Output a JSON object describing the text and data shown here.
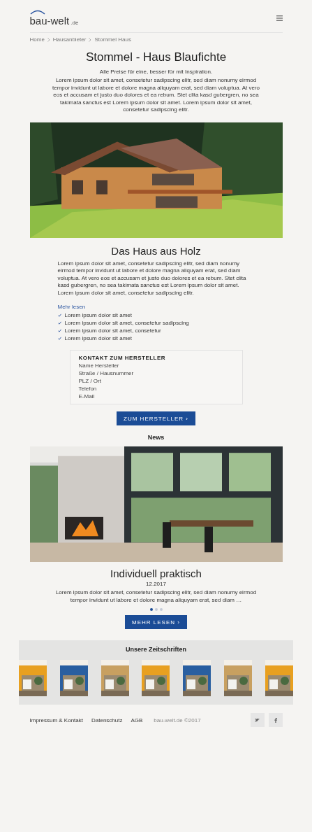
{
  "header": {
    "logo": "bau-welt",
    "logo_suffix": ".de"
  },
  "breadcrumb": [
    "Home",
    "Hausanbieter",
    "Stommel Haus"
  ],
  "title": "Stommel - Haus Blaufichte",
  "intro": "Alle Preise für eine, besser für mit Inspiration.",
  "description": "Lorem ipsum dolor sit amet, consetetur sadipscing elitr, sed diam nonumy eirmod tempor invidunt ut labore et dolore magna aliquyam erat, sed diam voluptua. At vero eos et accusam et justo duo dolores et ea rebum. Stet clita kasd gubergren, no sea takimata sanctus est Lorem ipsum dolor sit amet. Lorem ipsum dolor sit amet, consetetur sadipscing elitr.",
  "hero": {
    "kind": "picture"
  },
  "section": {
    "heading": "Das Haus aus Holz",
    "text": "Lorem ipsum dolor sit amet, consetetur sadipscing elitr, sed diam nonumy eirmod tempor invidunt ut labore et dolore magna aliquyam erat, sed diam voluptua. At vero eos et accusam et justo duo dolores et ea rebum. Stet clita kasd gubergren, no sea takimata sanctus est Lorem ipsum dolor sit amet. Lorem ipsum dolor sit amet, consetetur sadipscing elitr.",
    "link": "Mehr lesen",
    "features": [
      "Lorem ipsum dolor sit amet",
      "Lorem ipsum dolor sit amet, consetetur sadipscing",
      "Lorem ipsum dolor sit amet, consetetur",
      "Lorem ipsum dolor sit amet"
    ]
  },
  "contact": {
    "heading": "KONTAKT ZUM HERSTELLER",
    "lines": [
      "Name Hersteller",
      "Straße / Hausnummer",
      "PLZ / Ort",
      "Telefon",
      "E-Mail"
    ],
    "button": "ZUM HERSTELLER ›"
  },
  "news": {
    "heading": "News",
    "title": "Individuell praktisch",
    "date": "12.2017",
    "excerpt": "Lorem ipsum dolor sit amet, consetetur sadipscing elitr, sed diam nonumy eirmod tempor invidunt ut labore et dolore magna aliquyam erat, sed diam …",
    "dots": [
      {
        "selected": true
      },
      {
        "selected": false
      },
      {
        "selected": false
      }
    ],
    "button": "MEHR LESEN ›"
  },
  "magazines": {
    "heading": "Unsere Zeitschriften",
    "covers": [
      {
        "color": "#e8a020"
      },
      {
        "color": "#2a5fa0"
      },
      {
        "color": "#c8a060"
      },
      {
        "color": "#e8a020"
      },
      {
        "color": "#2a5fa0"
      },
      {
        "color": "#c8a060"
      },
      {
        "color": "#e8a020"
      }
    ]
  },
  "footer": {
    "links": [
      "Impressum & Kontakt",
      "Datenschutz",
      "AGB"
    ],
    "copyright": "bau-welt.de ©2017"
  }
}
